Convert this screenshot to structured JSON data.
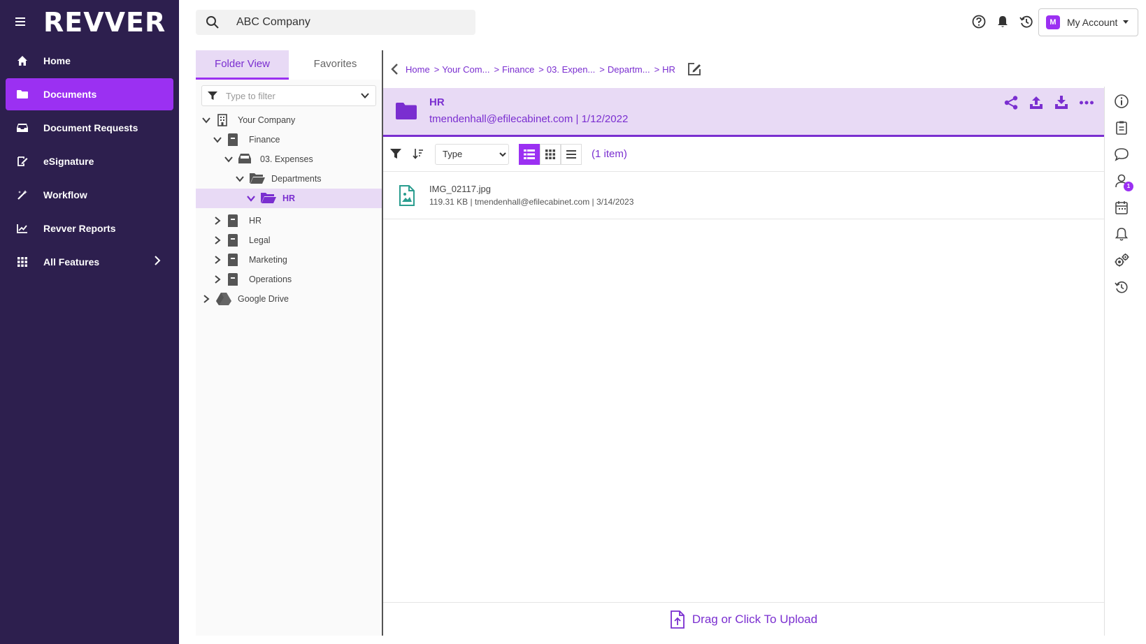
{
  "app": {
    "logo": "REVVER"
  },
  "sidebar": {
    "items": [
      {
        "label": "Home",
        "icon": "home-icon",
        "active": false
      },
      {
        "label": "Documents",
        "icon": "folder-icon",
        "active": true
      },
      {
        "label": "Document Requests",
        "icon": "inbox-icon",
        "active": false
      },
      {
        "label": "eSignature",
        "icon": "signature-icon",
        "active": false
      },
      {
        "label": "Workflow",
        "icon": "workflow-icon",
        "active": false
      },
      {
        "label": "Revver Reports",
        "icon": "chart-icon",
        "active": false
      },
      {
        "label": "All Features",
        "icon": "grid-icon",
        "active": false
      }
    ]
  },
  "search": {
    "value": "ABC Company"
  },
  "account": {
    "avatar_letter": "M",
    "label": "My Account"
  },
  "tree_panel": {
    "tabs": [
      {
        "label": "Folder View",
        "active": true
      },
      {
        "label": "Favorites",
        "active": false
      }
    ],
    "filter_placeholder": "Type to filter",
    "nodes": [
      {
        "label": "Your Company"
      },
      {
        "label": "Finance"
      },
      {
        "label": "03. Expenses"
      },
      {
        "label": "Departments"
      },
      {
        "label": "HR"
      },
      {
        "label": "HR"
      },
      {
        "label": "Legal"
      },
      {
        "label": "Marketing"
      },
      {
        "label": "Operations"
      },
      {
        "label": "Google Drive"
      }
    ]
  },
  "breadcrumb": {
    "items": [
      "Home",
      "Your Com...",
      "Finance",
      "03. Expen...",
      "Departm...",
      "HR"
    ],
    "separator": ">"
  },
  "folder": {
    "title": "HR",
    "subtitle": "tmendenhall@efilecabinet.com | 1/12/2022"
  },
  "toolbar": {
    "type_select": "Type",
    "count": "(1 item)"
  },
  "files": [
    {
      "name": "IMG_02117.jpg",
      "meta": "119.31 KB | tmendenhall@efilecabinet.com | 3/14/2023"
    }
  ],
  "upload": {
    "label": "Drag or Click To Upload"
  },
  "rail": {
    "user_badge": "1"
  },
  "colors": {
    "sidebar_bg": "#2d1f4e",
    "accent": "#9b30f2",
    "accent_dark": "#7a2ed0",
    "highlight_bg": "#e8daf5"
  }
}
